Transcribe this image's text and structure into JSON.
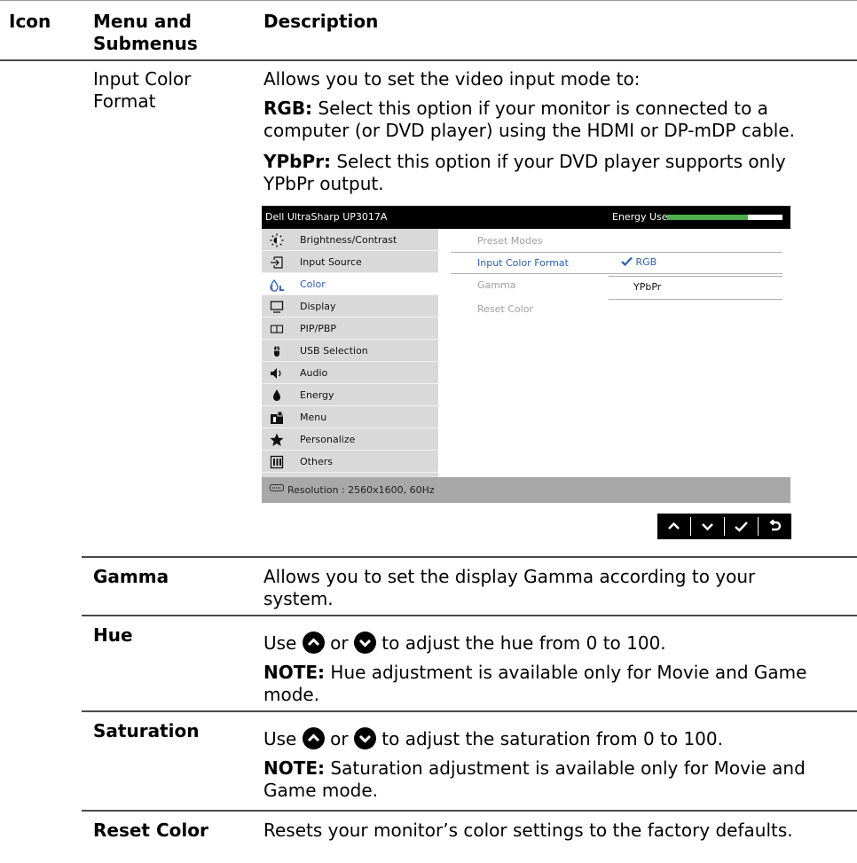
{
  "columns": {
    "icon": "Icon",
    "menu_line1": "Menu and",
    "menu_line2": "Submenus",
    "description": "Description"
  },
  "input_color_format": {
    "name_line1": "Input Color",
    "name_line2": "Format",
    "intro": "Allows you to set the video input mode to:",
    "rgb_label": "RGB:",
    "rgb_line1": " Select this option if your monitor is connected to a",
    "rgb_line2": "computer (or DVD player) using the HDMI or DP-mDP cable.",
    "ypbpr_label": "YPbPr:",
    "ypbpr_line1": " Select this option if your DVD player supports only",
    "ypbpr_line2": "YPbPr output."
  },
  "osd": {
    "model": "Dell UltraSharp UP3017A",
    "energy_label": "Energy Use",
    "energy_level": 0.7,
    "menu": [
      {
        "label": "Brightness/Contrast",
        "icon": "brightness-icon"
      },
      {
        "label": "Input Source",
        "icon": "input-source-icon"
      },
      {
        "label": "Color",
        "icon": "color-icon",
        "selected": true
      },
      {
        "label": "Display",
        "icon": "display-icon"
      },
      {
        "label": "PIP/PBP",
        "icon": "pip-icon"
      },
      {
        "label": "USB Selection",
        "icon": "usb-icon"
      },
      {
        "label": "Audio",
        "icon": "audio-icon"
      },
      {
        "label": "Energy",
        "icon": "energy-icon"
      },
      {
        "label": "Menu",
        "icon": "menu-icon"
      },
      {
        "label": "Personalize",
        "icon": "star-icon"
      },
      {
        "label": "Others",
        "icon": "others-icon"
      }
    ],
    "sub": {
      "preset_modes": "Preset Modes",
      "input_color_format": "Input Color Format",
      "gamma": "Gamma",
      "reset_color": "Reset Color",
      "option_rgb": "RGB",
      "option_ypbpr": "YPbPr"
    },
    "resolution": "Resolution : 2560x1600, 60Hz",
    "accent": "#2b5fb0",
    "energy_color": "#4cae4c"
  },
  "nav_buttons": [
    "up-icon",
    "down-icon",
    "check-icon",
    "back-icon"
  ],
  "gamma": {
    "name": "Gamma",
    "line1": "Allows you to set the display Gamma according to your",
    "line2": "system."
  },
  "hue": {
    "name": "Hue",
    "use": "Use",
    "or": "or",
    "rest": "to adjust the hue from 0 to 100.",
    "note_label": "NOTE:",
    "note_line1": " Hue adjustment is available only for Movie and Game",
    "note_line2": "mode."
  },
  "saturation": {
    "name": "Saturation",
    "use": "Use",
    "or": "or",
    "rest": "to adjust the saturation from 0 to 100.",
    "note_label": "NOTE:",
    "note_line1": " Saturation adjustment is available only for Movie and",
    "note_line2": "Game mode."
  },
  "reset_color": {
    "name": "Reset Color",
    "desc": "Resets your monitor’s color settings to the factory defaults."
  }
}
